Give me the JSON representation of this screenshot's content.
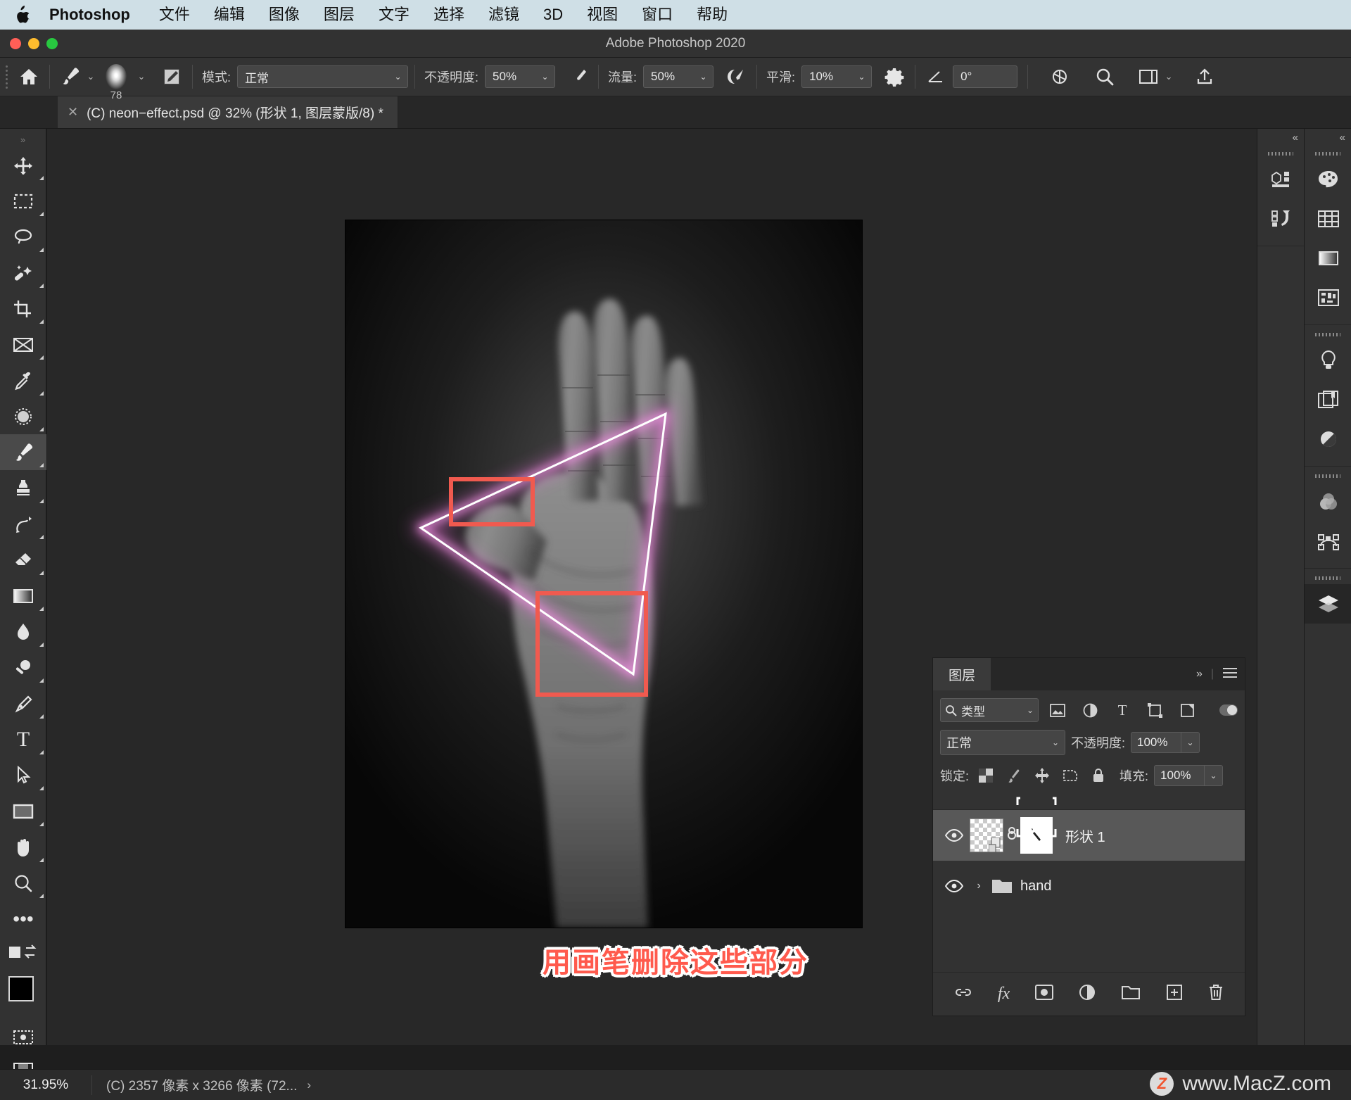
{
  "menubar": {
    "apple_icon": "apple-icon",
    "brand": "Photoshop",
    "items": [
      "文件",
      "编辑",
      "图像",
      "图层",
      "文字",
      "选择",
      "滤镜",
      "3D",
      "视图",
      "窗口",
      "帮助"
    ]
  },
  "window": {
    "title": "Adobe Photoshop 2020"
  },
  "optionsbar": {
    "home_icon": "home-icon",
    "brush_icon": "brush-tool-icon",
    "brush_size": "78",
    "brush_settings_icon": "brush-settings-icon",
    "mode_label": "模式:",
    "mode_value": "正常",
    "opacity_label": "不透明度:",
    "opacity_value": "50%",
    "pressure_opacity_icon": "pressure-opacity-icon",
    "flow_label": "流量:",
    "flow_value": "50%",
    "airbrush_icon": "airbrush-icon",
    "smoothing_label": "平滑:",
    "smoothing_value": "10%",
    "gear_icon": "gear-icon",
    "angle_icon": "brush-angle-icon",
    "angle_value": "0°",
    "symmetry_icon": "symmetry-icon",
    "search_icon": "search-icon",
    "workspace_icon": "workspace-icon",
    "share_icon": "share-icon"
  },
  "document_tab": {
    "close_icon": "close-icon",
    "title": "(C) neon−effect.psd @ 32% (形状 1, 图层蒙版/8) *"
  },
  "toolbar": {
    "tools": [
      {
        "name": "move-tool",
        "icon": "move-icon",
        "selected": false
      },
      {
        "name": "marquee-tool",
        "icon": "rect-marquee-icon",
        "selected": false
      },
      {
        "name": "lasso-tool",
        "icon": "lasso-icon",
        "selected": false
      },
      {
        "name": "quick-select-tool",
        "icon": "magic-wand-icon",
        "selected": false
      },
      {
        "name": "crop-tool",
        "icon": "crop-icon",
        "selected": false
      },
      {
        "name": "frame-tool",
        "icon": "frame-icon",
        "selected": false
      },
      {
        "name": "eyedropper-tool",
        "icon": "eyedropper-icon",
        "selected": false
      },
      {
        "name": "spot-heal-tool",
        "icon": "healing-brush-icon",
        "selected": false
      },
      {
        "name": "brush-tool",
        "icon": "brush-icon",
        "selected": true
      },
      {
        "name": "clone-stamp-tool",
        "icon": "clone-stamp-icon",
        "selected": false
      },
      {
        "name": "history-brush-tool",
        "icon": "history-brush-icon",
        "selected": false
      },
      {
        "name": "eraser-tool",
        "icon": "eraser-icon",
        "selected": false
      },
      {
        "name": "gradient-tool",
        "icon": "gradient-icon",
        "selected": false
      },
      {
        "name": "blur-tool",
        "icon": "blur-drop-icon",
        "selected": false
      },
      {
        "name": "dodge-tool",
        "icon": "dodge-icon",
        "selected": false
      },
      {
        "name": "pen-tool",
        "icon": "pen-icon",
        "selected": false
      },
      {
        "name": "type-tool",
        "icon": "type-t-icon",
        "selected": false
      },
      {
        "name": "path-select-tool",
        "icon": "path-arrow-icon",
        "selected": false
      },
      {
        "name": "shape-tool",
        "icon": "rectangle-icon",
        "selected": false
      },
      {
        "name": "hand-tool",
        "icon": "hand-icon",
        "selected": false
      },
      {
        "name": "zoom-tool",
        "icon": "zoom-magnifier-icon",
        "selected": false
      },
      {
        "name": "more-tools",
        "icon": "ellipsis-icon",
        "selected": false
      },
      {
        "name": "edit-toolbar",
        "icon": "edit-toolbar-icon",
        "selected": false
      }
    ],
    "foreground_color": "#000000",
    "background_color": "#ffffff",
    "quick-mask-icon": "quick-mask-icon",
    "screen-mode-icon": "screen-mode-icon"
  },
  "canvas": {
    "annotation": "用画笔删除这些部分",
    "red_boxes": 2,
    "neon_color": "#f07ae0"
  },
  "right_dock": {
    "col_a": [
      "3d-panel-icon",
      "history-actions-icon"
    ],
    "col_b_group1": [
      "color-palette-icon",
      "swatches-grid-icon",
      "gradients-icon",
      "patterns-icon"
    ],
    "col_b_group2": [
      "adjustments-bulb-icon",
      "libraries-icon",
      "adjustment-half-circle-icon"
    ],
    "col_b_group3": [
      "channels-venn-icon",
      "paths-icon"
    ],
    "col_b_group4": [
      "layers-stack-icon"
    ],
    "collapse_icon": "collapse-chevrons-icon",
    "menu_icon": "panel-menu-icon"
  },
  "layers_panel": {
    "tab_label": "图层",
    "collapse_icon": "collapse-chevrons-icon",
    "menu_icon": "panel-menu-icon",
    "filter": {
      "search_icon": "search-icon",
      "type_label": "类型",
      "icons": [
        "filter-pixel-icon",
        "filter-adjustment-icon",
        "filter-type-icon",
        "filter-shape-icon",
        "filter-smart-icon"
      ],
      "toggle_on": true
    },
    "blend_mode": "正常",
    "opacity_label": "不透明度:",
    "opacity_value": "100%",
    "lock_label": "锁定:",
    "lock_icons": [
      "lock-transparent-icon",
      "lock-image-icon",
      "lock-position-icon",
      "lock-artboard-icon",
      "lock-all-icon"
    ],
    "fill_label": "填充:",
    "fill_value": "100%",
    "layers": [
      {
        "name": "形状 1",
        "type": "shape",
        "visible": true,
        "selected": true,
        "has_mask": true,
        "linked": true
      },
      {
        "name": "hand",
        "type": "group",
        "visible": true,
        "selected": false,
        "expanded": false
      }
    ],
    "footer_icons": [
      "link-layers-icon",
      "layer-fx-icon",
      "add-mask-icon",
      "adjustment-layer-icon",
      "new-group-icon",
      "new-layer-icon",
      "delete-layer-icon"
    ]
  },
  "statusbar": {
    "zoom": "31.95%",
    "doc_info": "(C) 2357 像素 x 3266 像素 (72...",
    "expand_icon": "chevron-right-icon"
  },
  "watermark": {
    "badge": "Z",
    "text": "www.MacZ.com"
  }
}
